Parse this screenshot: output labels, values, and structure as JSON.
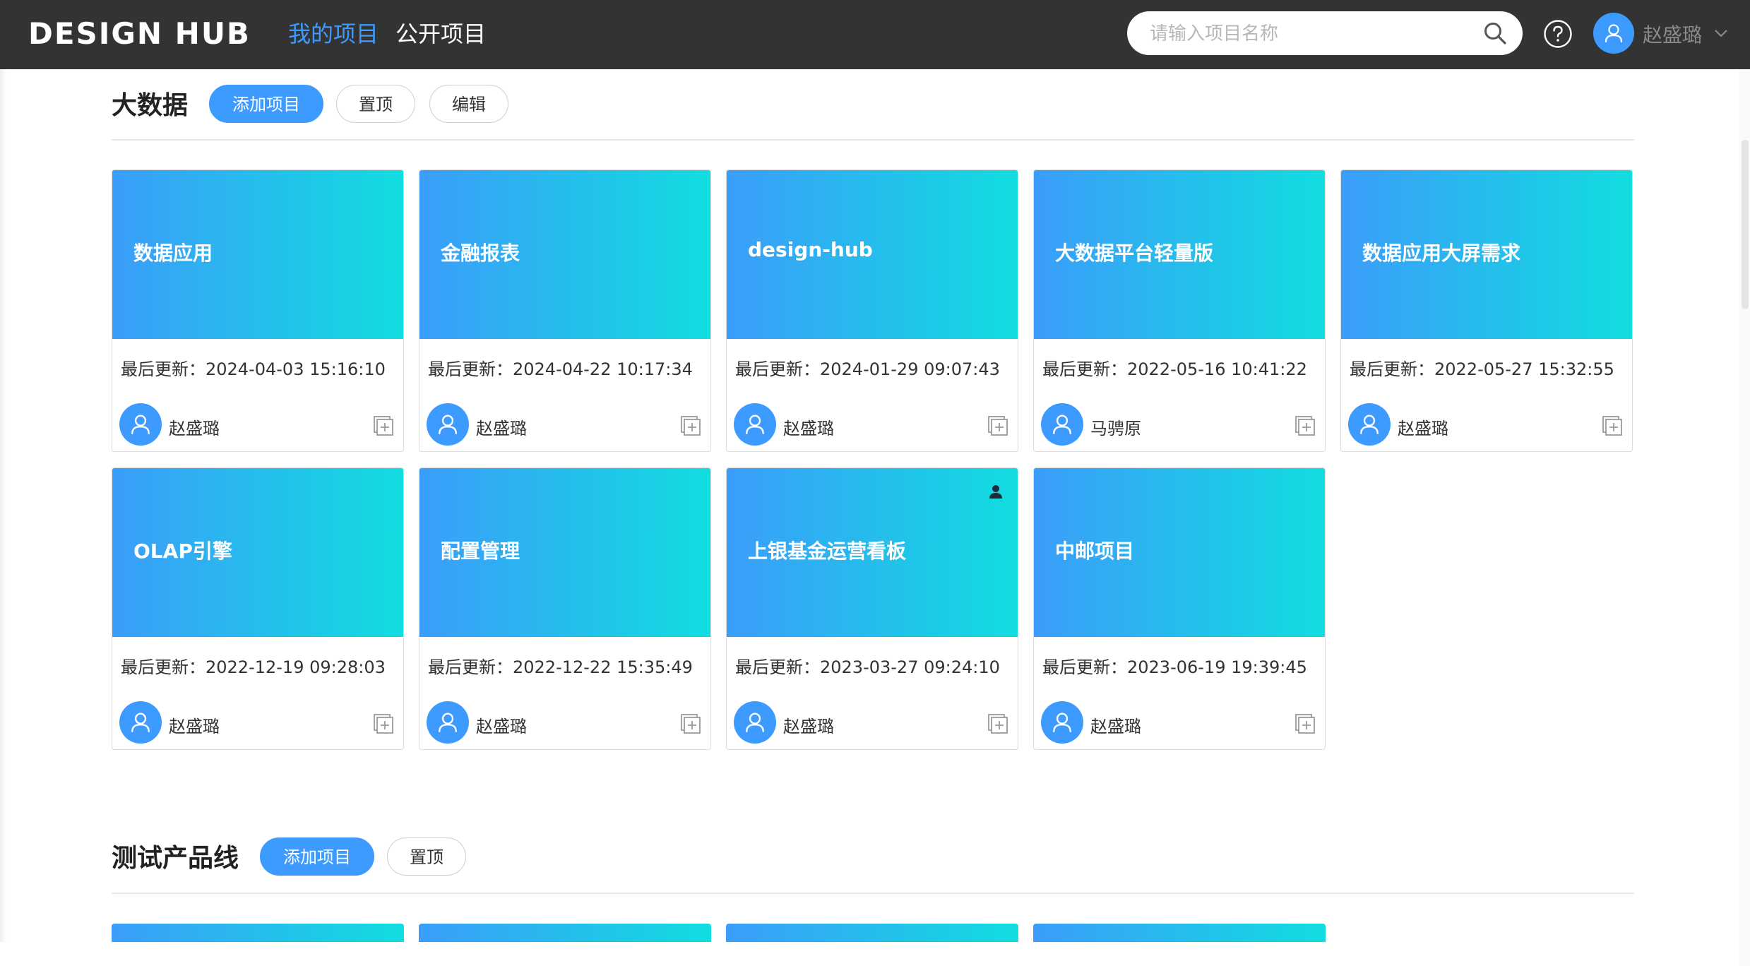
{
  "header": {
    "logo": "DESIGN HUB",
    "tabs": [
      {
        "label": "我的项目",
        "active": true
      },
      {
        "label": "公开项目",
        "active": false
      }
    ],
    "search": {
      "placeholder": "请输入项目名称",
      "value": ""
    },
    "user": {
      "name": "赵盛璐"
    }
  },
  "colors": {
    "topbar": "#333333",
    "accent": "#3d9bff",
    "card_gradient_start": "#3b9dfa",
    "card_gradient_end": "#12dde0"
  },
  "sections": [
    {
      "title": "大数据",
      "buttons": {
        "add": "添加项目",
        "pin": "置顶",
        "edit": "编辑"
      },
      "cards": [
        {
          "title": "数据应用",
          "updated": "最后更新：2024-04-03 15:16:10",
          "owner": "赵盛璐",
          "owner_badge": false
        },
        {
          "title": "金融报表",
          "updated": "最后更新：2024-04-22 10:17:34",
          "owner": "赵盛璐",
          "owner_badge": false
        },
        {
          "title": "design-hub",
          "updated": "最后更新：2024-01-29 09:07:43",
          "owner": "赵盛璐",
          "owner_badge": false
        },
        {
          "title": "大数据平台轻量版",
          "updated": "最后更新：2022-05-16 10:41:22",
          "owner": "马骋原",
          "owner_badge": false
        },
        {
          "title": "数据应用大屏需求",
          "updated": "最后更新：2022-05-27 15:32:55",
          "owner": "赵盛璐",
          "owner_badge": false
        },
        {
          "title": "OLAP引擎",
          "updated": "最后更新：2022-12-19 09:28:03",
          "owner": "赵盛璐",
          "owner_badge": false
        },
        {
          "title": "配置管理",
          "updated": "最后更新：2022-12-22 15:35:49",
          "owner": "赵盛璐",
          "owner_badge": false
        },
        {
          "title": "上银基金运营看板",
          "updated": "最后更新：2023-03-27 09:24:10",
          "owner": "赵盛璐",
          "owner_badge": true
        },
        {
          "title": "中邮项目",
          "updated": "最后更新：2023-06-19 19:39:45",
          "owner": "赵盛璐",
          "owner_badge": false
        }
      ]
    },
    {
      "title": "测试产品线",
      "buttons": {
        "add": "添加项目",
        "pin": "置顶"
      }
    }
  ],
  "icons": {
    "search": "search-icon",
    "help": "help-icon",
    "avatar": "user-icon",
    "dropdown": "chevron-down-icon",
    "copy": "copy-icon",
    "owner_badge": "person-icon"
  }
}
